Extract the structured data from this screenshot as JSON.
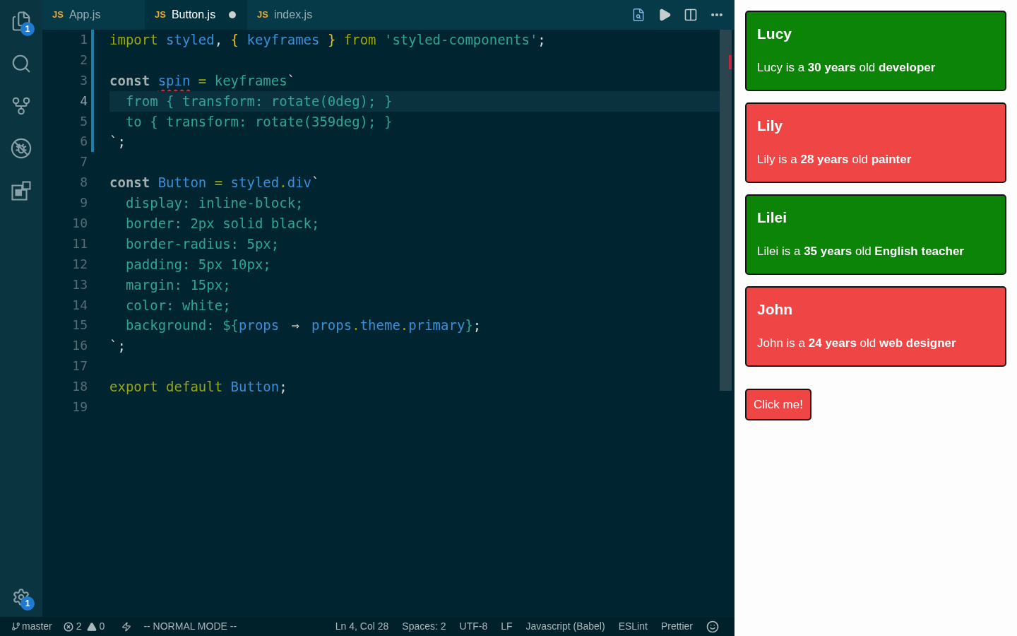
{
  "activity_bar": {
    "items": [
      {
        "kind": "explorer",
        "badge": "1"
      },
      {
        "kind": "search"
      },
      {
        "kind": "source_control"
      },
      {
        "kind": "debug"
      },
      {
        "kind": "extensions"
      }
    ],
    "settings": {
      "badge": "1"
    }
  },
  "tabs": [
    {
      "badge": "JS",
      "label": "App.js",
      "selected": false,
      "modified": false
    },
    {
      "badge": "JS",
      "label": "Button.js",
      "selected": true,
      "modified": true
    },
    {
      "badge": "JS",
      "label": "index.js",
      "selected": false,
      "modified": false
    }
  ],
  "editor": {
    "lines": [
      {
        "number": "1",
        "changed": true,
        "current": false,
        "tokens": [
          {
            "text": "import",
            "kind": "keyword"
          },
          {
            "text": " styled",
            "kind": "ident"
          },
          {
            "text": ",",
            "kind": "punct"
          },
          {
            "text": " {",
            "kind": "bracket"
          },
          {
            "text": " keyframes",
            "kind": "ident"
          },
          {
            "text": " }",
            "kind": "bracket"
          },
          {
            "text": " from",
            "kind": "keyword"
          },
          {
            "text": " 'styled-components'",
            "kind": "string"
          },
          {
            "text": ";",
            "kind": "punct"
          }
        ]
      },
      {
        "number": "2",
        "changed": true,
        "current": false
      },
      {
        "number": "3",
        "changed": true,
        "current": false,
        "tokens": [
          {
            "text": "const ",
            "kind": "storage"
          },
          {
            "text": "spin",
            "kind": "ident_error"
          },
          {
            "text": " =",
            "kind": "operator"
          },
          {
            "text": " keyframes",
            "kind": "string"
          },
          {
            "text": "`",
            "kind": "punct"
          }
        ]
      },
      {
        "number": "4",
        "changed": true,
        "current": true,
        "tokens": [
          {
            "text": "  from { transform: rotate(0deg); }",
            "kind": "string"
          }
        ]
      },
      {
        "number": "5",
        "changed": true,
        "current": false,
        "tokens": [
          {
            "text": "  to { transform: rotate(359deg); }",
            "kind": "string"
          }
        ]
      },
      {
        "number": "6",
        "changed": true,
        "current": false,
        "tokens": [
          {
            "text": "`;",
            "kind": "punct"
          }
        ]
      },
      {
        "number": "7",
        "changed": false,
        "current": false
      },
      {
        "number": "8",
        "changed": false,
        "current": false,
        "tokens": [
          {
            "text": "const ",
            "kind": "storage"
          },
          {
            "text": "Button",
            "kind": "ident"
          },
          {
            "text": " =",
            "kind": "operator"
          },
          {
            "text": " styled",
            "kind": "ident"
          },
          {
            "text": ".",
            "kind": "operator"
          },
          {
            "text": "div",
            "kind": "ident"
          },
          {
            "text": "`",
            "kind": "punct"
          }
        ]
      },
      {
        "number": "9",
        "changed": false,
        "current": false,
        "tokens": [
          {
            "text": "  display: inline-block;",
            "kind": "string"
          }
        ]
      },
      {
        "number": "10",
        "changed": false,
        "current": false,
        "tokens": [
          {
            "text": "  border: 2px solid black;",
            "kind": "string"
          }
        ]
      },
      {
        "number": "11",
        "changed": false,
        "current": false,
        "tokens": [
          {
            "text": "  border-radius: 5px;",
            "kind": "string"
          }
        ]
      },
      {
        "number": "12",
        "changed": false,
        "current": false,
        "tokens": [
          {
            "text": "  padding: 5px 10px;",
            "kind": "string"
          }
        ]
      },
      {
        "number": "13",
        "changed": false,
        "current": false,
        "tokens": [
          {
            "text": "  margin: 15px;",
            "kind": "string"
          }
        ]
      },
      {
        "number": "14",
        "changed": false,
        "current": false,
        "tokens": [
          {
            "text": "  color: white;",
            "kind": "string"
          }
        ]
      },
      {
        "number": "15",
        "changed": false,
        "current": false,
        "tokens": [
          {
            "text": "  background: ${",
            "kind": "string"
          },
          {
            "text": "props ",
            "kind": "ident"
          },
          {
            "text": "⇒",
            "kind": "ligature"
          },
          {
            "text": " props",
            "kind": "ident"
          },
          {
            "text": ".",
            "kind": "operator"
          },
          {
            "text": "theme",
            "kind": "ident"
          },
          {
            "text": ".",
            "kind": "operator"
          },
          {
            "text": "primary",
            "kind": "ident"
          },
          {
            "text": "}",
            "kind": "string"
          },
          {
            "text": ";",
            "kind": "punct"
          }
        ]
      },
      {
        "number": "16",
        "changed": false,
        "current": false,
        "tokens": [
          {
            "text": "`;",
            "kind": "punct"
          }
        ]
      },
      {
        "number": "17",
        "changed": false,
        "current": false
      },
      {
        "number": "18",
        "changed": false,
        "current": false,
        "tokens": [
          {
            "text": "export default",
            "kind": "keyword"
          },
          {
            "text": " Button",
            "kind": "ident"
          },
          {
            "text": ";",
            "kind": "punct"
          }
        ]
      },
      {
        "number": "19",
        "changed": false,
        "current": false
      }
    ]
  },
  "status_bar": {
    "branch": "master",
    "errors": "2",
    "warnings": "0",
    "mode": "-- NORMAL MODE --",
    "items": [
      "Ln 4, Col 28",
      "Spaces: 2",
      "UTF-8",
      "LF",
      "Javascript (Babel)",
      "ESLint",
      "Prettier"
    ]
  },
  "preview": {
    "cards": [
      {
        "name": "Lucy",
        "description": "Lucy is a **30 years** old **developer**",
        "color": "#0b8407"
      },
      {
        "name": "Lily",
        "description": "Lily is a **28 years** old **painter**",
        "color": "#ef4545"
      },
      {
        "name": "Lilei",
        "description": "Lilei is a **35 years** old **English teacher**",
        "color": "#0b8407"
      },
      {
        "name": "John",
        "description": "John is a **24 years** old **web designer**",
        "color": "#ef4545"
      }
    ],
    "button": {
      "label": "Click me!"
    }
  }
}
